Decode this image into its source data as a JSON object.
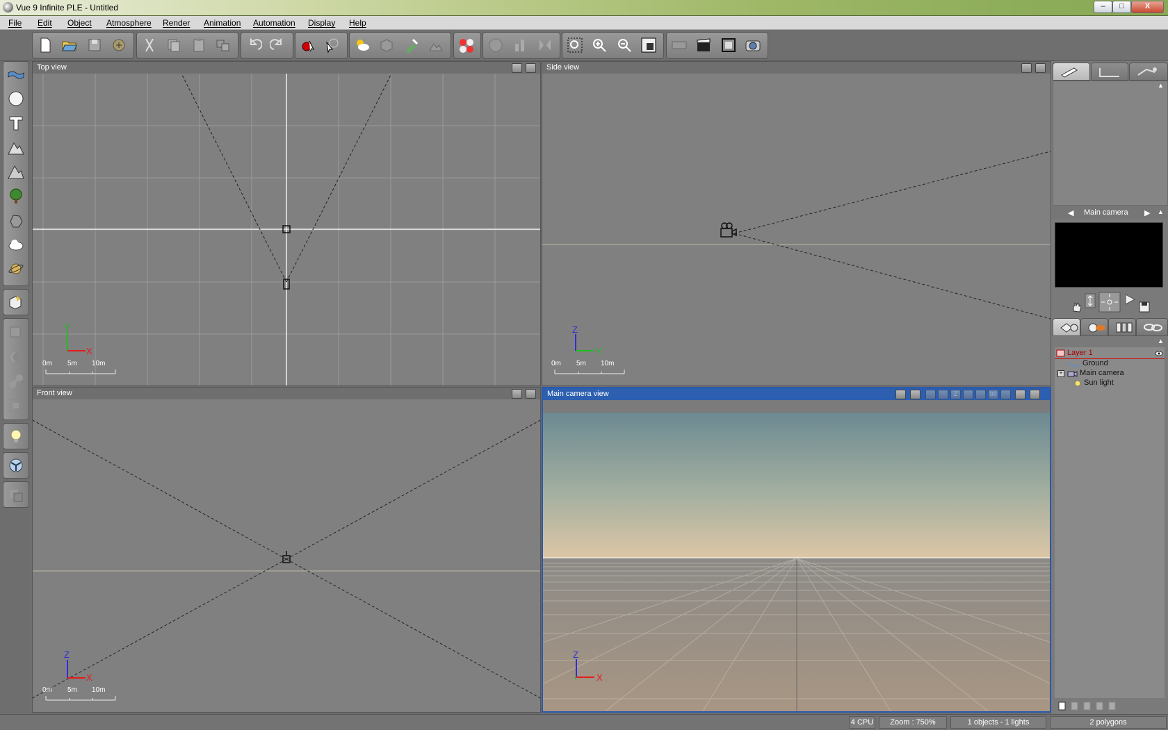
{
  "window": {
    "title": "Vue 9 Infinite PLE - Untitled",
    "min_glyph": "–",
    "max_glyph": "□",
    "close_glyph": "X"
  },
  "menu": [
    "File",
    "Edit",
    "Object",
    "Atmosphere",
    "Render",
    "Animation",
    "Automation",
    "Display",
    "Help"
  ],
  "toolbar": {
    "groups": [
      [
        "new-icon",
        "open-icon",
        "save-icon",
        "save-as-icon"
      ],
      [
        "cut-icon",
        "copy-icon",
        "paste-icon",
        "duplicate-icon"
      ],
      [
        "undo-icon",
        "redo-icon"
      ],
      [
        "record-icon",
        "select-icon"
      ],
      [
        "sky-icon",
        "atmosphere-icon",
        "paint-icon",
        "terrain-editor-icon"
      ],
      [
        "materials-icon"
      ],
      [
        "sphere-disabled-icon",
        "align-icon",
        "mirror-icon"
      ],
      [
        "zoom-region-icon",
        "zoom-in-icon",
        "zoom-out-icon",
        "fit-icon"
      ],
      [
        "film-icon",
        "clapper-icon",
        "frame-icon",
        "render-icon"
      ]
    ]
  },
  "left_tools": [
    [
      "plane-icon",
      "sphere-icon",
      "text-icon",
      "terrain-icon",
      "mountain-icon",
      "tree-icon",
      "rock-icon",
      "cloud-icon",
      "planet-icon"
    ],
    [
      "import-object-icon"
    ],
    [
      "boolean-union-icon",
      "boolean-diff-icon",
      "metablob-icon",
      "group-icon"
    ],
    [
      "light-icon"
    ],
    [
      "ecosystem-icon"
    ],
    [
      "layers-icon"
    ]
  ],
  "viewports": {
    "top": {
      "title": "Top view",
      "axis_a": "Y",
      "axis_b": "X",
      "scale": [
        "0m",
        "5m",
        "10m"
      ]
    },
    "side": {
      "title": "Side view",
      "axis_a": "Z",
      "axis_b": "Y",
      "scale": [
        "0m",
        "5m",
        "10m"
      ]
    },
    "front": {
      "title": "Front view",
      "axis_a": "Z",
      "axis_b": "X",
      "scale": [
        "0m",
        "5m",
        "10m"
      ]
    },
    "camera": {
      "title": "Main camera view",
      "axis_a": "Z",
      "axis_b": "X",
      "z_btn": "Z",
      "nine_btn": "00"
    }
  },
  "right_panel": {
    "tabs": [
      "object-properties-icon",
      "aspect-icon",
      "animation-icon"
    ],
    "camera_name": "Main camera",
    "world_tabs": [
      "objects-icon",
      "materials-browser-icon",
      "library-icon",
      "links-icon"
    ],
    "tree": {
      "layer": "Layer 1",
      "items": [
        "Ground",
        "Main camera",
        "Sun light"
      ],
      "expander": "+"
    }
  },
  "status": {
    "cpu": "4 CPU",
    "zoom": "Zoom : 750%",
    "objects": "1 objects - 1 lights",
    "polygons": "2 polygons"
  },
  "colors": {
    "active_border": "#2a58ad",
    "layer_color": "#b00000",
    "viewport_bg": "#808080"
  }
}
